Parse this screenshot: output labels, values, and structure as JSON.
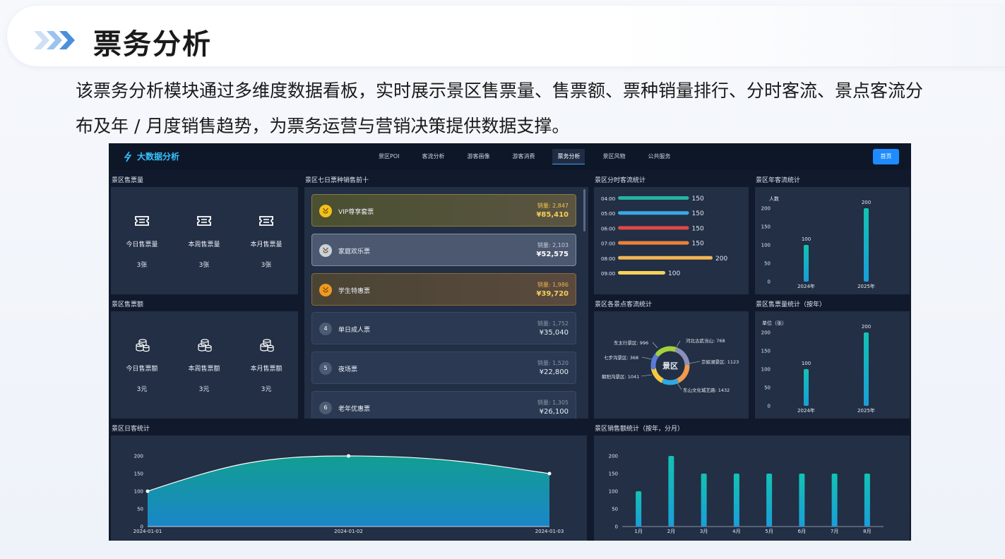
{
  "slide": {
    "title": "票务分析",
    "description": "该票务分析模块通过多维度数据看板，实时展示景区售票量、售票额、票种销量排行、分时客流、景点客流分布及年 / 月度销售趋势，为票务运营与营销决策提供数据支撑。"
  },
  "dashboard": {
    "brand": "大数据分析",
    "nav": [
      "景区POI",
      "客流分析",
      "游客画像",
      "游客消费",
      "票务分析",
      "景区风物",
      "公共服务"
    ],
    "nav_active": "票务分析",
    "home_button": "首页",
    "ticket_volume": {
      "title": "景区售票量",
      "items": [
        {
          "label": "今日售票量",
          "value": "3张"
        },
        {
          "label": "本周售票量",
          "value": "3张"
        },
        {
          "label": "本月售票量",
          "value": "3张"
        }
      ]
    },
    "ticket_amount": {
      "title": "景区售票额",
      "items": [
        {
          "label": "今日售票额",
          "value": "3元"
        },
        {
          "label": "本周售票额",
          "value": "3元"
        },
        {
          "label": "本月售票额",
          "value": "3元"
        }
      ]
    },
    "ranking": {
      "title": "景区七日票种销售前十",
      "items": [
        {
          "rank": "1",
          "name": "VIP尊享套票",
          "sales": "销量: 2,847",
          "amount": "¥85,410"
        },
        {
          "rank": "2",
          "name": "家庭欢乐票",
          "sales": "销量: 2,103",
          "amount": "¥52,575"
        },
        {
          "rank": "3",
          "name": "学生特惠票",
          "sales": "销量: 1,986",
          "amount": "¥39,720"
        },
        {
          "rank": "4",
          "name": "单日成人票",
          "sales": "销量: 1,752",
          "amount": "¥35,040"
        },
        {
          "rank": "5",
          "name": "夜场票",
          "sales": "销量: 1,520",
          "amount": "¥22,800"
        },
        {
          "rank": "6",
          "name": "老年优惠票",
          "sales": "销量: 1,305",
          "amount": "¥26,100"
        }
      ]
    },
    "hourly": {
      "title": "景区分时客流统计",
      "times": [
        "04:00",
        "05:00",
        "06:00",
        "07:00",
        "08:00",
        "09:00"
      ],
      "values": [
        150,
        150,
        150,
        150,
        200,
        100
      ],
      "colors": [
        "#26b3a4",
        "#3ba7e6",
        "#e04848",
        "#e8823a",
        "#f1b455",
        "#f4d25a"
      ]
    },
    "spots": {
      "title": "景区各景点客流统计",
      "center": "景区",
      "labels": [
        "东太行景区: 996",
        "河北古武当山: 768",
        "七步沟景区: 368",
        "京娘湖景区: 1123",
        "朝阳沟景区: 1041",
        "东山文化城艺路: 1432"
      ],
      "colors": [
        "#f5c842",
        "#5b7bd5",
        "#2fa9e0",
        "#a3d13b",
        "#f19a4b",
        "#8a90b8"
      ]
    },
    "mini_a": {
      "prefix": "<"
    },
    "year_flow": {
      "title": "景区年客流统计"
    },
    "year_sales": {
      "title": "景区售票量统计（按年）"
    },
    "daily": {
      "title": "景区日客统计"
    },
    "monthly": {
      "title": "景区销售额统计（按年，分月）"
    }
  },
  "chart_data": [
    {
      "type": "bar",
      "title": "景区年客流统计",
      "ylabel": "人数",
      "categories": [
        "2024年",
        "2025年"
      ],
      "values": [
        100,
        200
      ],
      "ylim": [
        0,
        200
      ],
      "yticks": [
        0,
        50,
        100,
        150,
        200
      ],
      "color": "#14b8c8"
    },
    {
      "type": "bar",
      "title": "景区售票量统计（按年）",
      "ylabel": "单位（张）",
      "categories": [
        "2024年",
        "2025年"
      ],
      "values": [
        100,
        200
      ],
      "ylim": [
        0,
        200
      ],
      "yticks": [
        0,
        50,
        100,
        150,
        200
      ],
      "color": "#14b8c8"
    },
    {
      "type": "area",
      "title": "景区日客统计",
      "x": [
        "2024-01-01",
        "2024-01-02",
        "2024-01-03"
      ],
      "values": [
        100,
        200,
        150
      ],
      "ylim": [
        0,
        200
      ],
      "yticks": [
        0,
        50,
        100,
        150,
        200
      ]
    },
    {
      "type": "bar",
      "title": "景区销售额统计（按年，分月）",
      "categories": [
        "1月",
        "2月",
        "3月",
        "4月",
        "5月",
        "6月",
        "7月",
        "8月"
      ],
      "values": [
        100,
        200,
        150,
        150,
        150,
        150,
        150,
        150
      ],
      "ylim": [
        0,
        200
      ],
      "yticks": [
        0,
        50,
        100,
        150,
        200
      ],
      "color": "#14b8c8"
    },
    {
      "type": "bar",
      "title": "景区分时客流统计",
      "categories": [
        "04:00",
        "05:00",
        "06:00",
        "07:00",
        "08:00",
        "09:00"
      ],
      "values": [
        150,
        150,
        150,
        150,
        200,
        100
      ],
      "orientation": "horizontal"
    },
    {
      "type": "pie",
      "title": "景区各景点客流统计",
      "categories": [
        "东太行景区",
        "河北古武当山",
        "七步沟景区",
        "京娘湖景区",
        "朝阳沟景区",
        "东山文化城艺路"
      ],
      "values": [
        996,
        768,
        368,
        1123,
        1041,
        1432
      ]
    }
  ]
}
